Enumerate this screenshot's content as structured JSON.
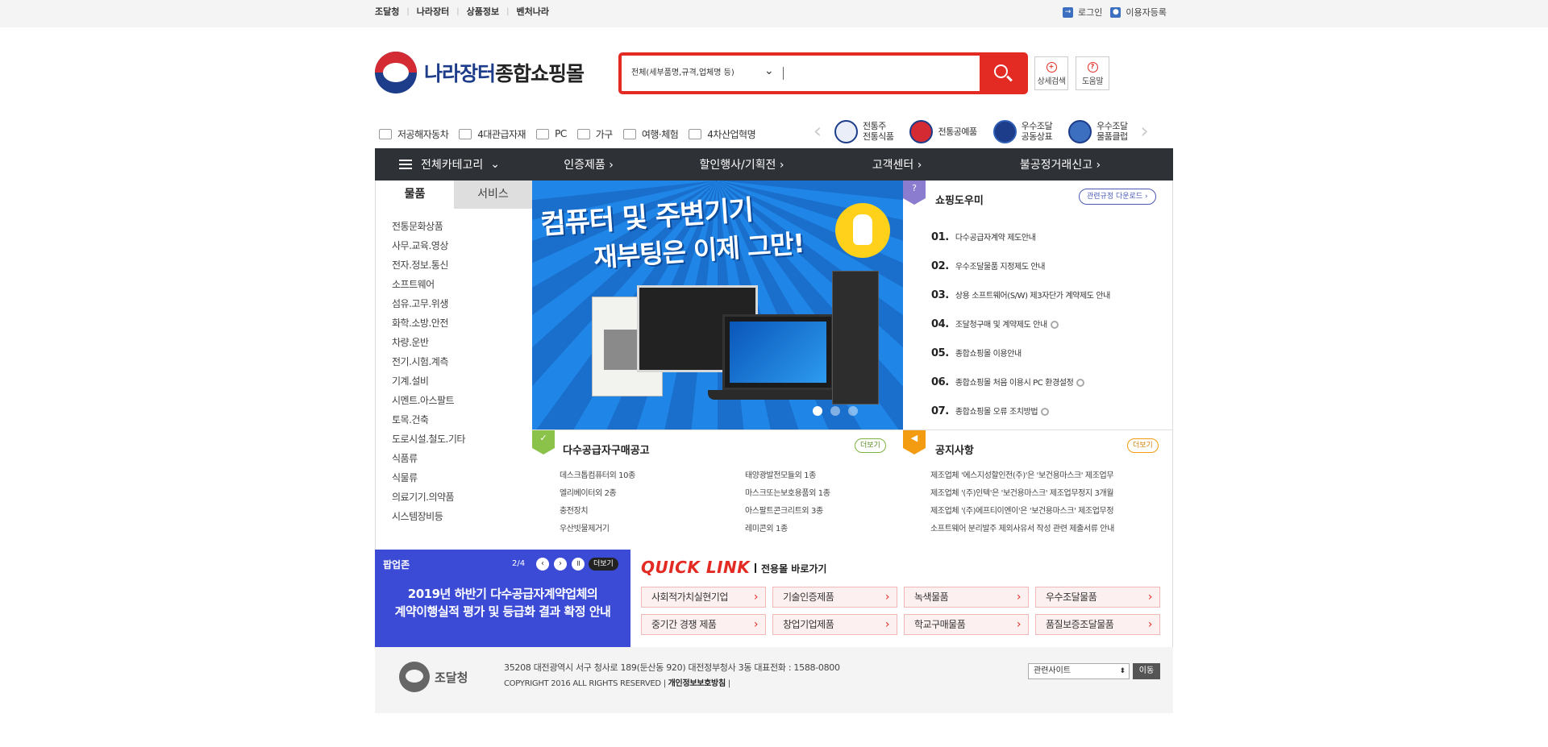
{
  "topbar": {
    "links": [
      "조달청",
      "나라장터",
      "상품정보",
      "벤처나라"
    ],
    "login": "로그인",
    "register": "이용자등록"
  },
  "header": {
    "logo_main": "나라장터",
    "logo_sub": "종합쇼핑몰",
    "search_scope": "전체(세부품명,규격,업체명 등)",
    "search_placeholder": "",
    "detail_search": "상세검색",
    "help": "도움말"
  },
  "quick_categories": [
    {
      "label": "저공해자동차",
      "icon": "car-icon"
    },
    {
      "label": "4대관급자재",
      "icon": "material-icon"
    },
    {
      "label": "PC",
      "icon": "pc-icon"
    },
    {
      "label": "가구",
      "icon": "furniture-icon"
    },
    {
      "label": "여행·체험",
      "icon": "travel-icon"
    },
    {
      "label": "4차산업혁명",
      "icon": "industry-icon"
    }
  ],
  "specials": [
    {
      "line1": "전통주",
      "line2": "전통식품"
    },
    {
      "line1": "전통공예품",
      "line2": ""
    },
    {
      "line1": "우수조달",
      "line2": "공동상표"
    },
    {
      "line1": "우수조달",
      "line2": "물품클럽"
    }
  ],
  "mainnav": {
    "all": "전체카테고리",
    "items": [
      "인증제품",
      "할인행사/기획전",
      "고객센터",
      "불공정거래신고"
    ]
  },
  "category_panel": {
    "tabs": [
      "물품",
      "서비스"
    ],
    "items": [
      "전통문화상품",
      "사무.교육.영상",
      "전자.정보.통신",
      "소프트웨어",
      "섬유.고무.위생",
      "화학.소방.안전",
      "차량.운반",
      "전기.시험.계측",
      "기계.설비",
      "시멘트.아스팔트",
      "토목.건축",
      "도로시설.철도.기타",
      "식품류",
      "식물류",
      "의료기기.의약품",
      "시스템장비등"
    ]
  },
  "banner": {
    "line1": "컴퓨터 및 주변기기",
    "line2": "재부팅은 이제 그만!"
  },
  "help_panel": {
    "title": "쇼핑도우미",
    "download": "관련규정 다운로드",
    "items": [
      {
        "num": "01.",
        "text": "다수공급자계약 제도안내"
      },
      {
        "num": "02.",
        "text": "우수조달물품 지정제도 안내"
      },
      {
        "num": "03.",
        "text": "상용 소프트웨어(S/W) 제3자단가 계약제도 안내"
      },
      {
        "num": "04.",
        "text": "조달청구매 및 계약제도 안내"
      },
      {
        "num": "05.",
        "text": "종합쇼핑몰 이용안내"
      },
      {
        "num": "06.",
        "text": "종합쇼핑몰 처음 이용시 PC 환경설정"
      },
      {
        "num": "07.",
        "text": "종합쇼핑몰 오류 조치방법"
      }
    ]
  },
  "bulk_panel": {
    "title": "다수공급자구매공고",
    "more": "더보기",
    "items": [
      "데스크톱컴퓨터외 10종",
      "태양광발전모듈외 1종",
      "엘리베이터외 2종",
      "마스크또는보호용품외 1종",
      "충전장치",
      "아스팔트콘크리트외 3종",
      "우산빗물제거기",
      "레미콘외 1종"
    ]
  },
  "notice_panel": {
    "title": "공지사항",
    "more": "더보기",
    "items": [
      "제조업체 '에스지성할인전(주)'은 '보건용마스크' 제조업무",
      "제조업체 '(주)인텍'은 '보건용마스크' 제조업무정지 3개월",
      "제조업체 '(주)에프티이엔이'은 '보건용마스크' 제조업무정",
      "소프트웨어 분리발주 제외사유서 작성 관련 제출서류 안내"
    ]
  },
  "popup": {
    "title": "팝업존",
    "page": "2/4",
    "more": "더보기",
    "line1": "2019년 하반기 다수공급자계약업체의",
    "line2": "계약이행실적 평가 및 등급화 결과 확정 안내"
  },
  "quicklink": {
    "title": "QUICK LINK",
    "subtitle": "전용몰 바로가기",
    "buttons": [
      "사회적가치실현기업",
      "기술인증제품",
      "녹색물품",
      "우수조달물품",
      "중기간 경쟁 제품",
      "창업기업제품",
      "학교구매물품",
      "품질보증조달물품"
    ]
  },
  "footer": {
    "logo": "조달청",
    "address": "35208 대전광역시 서구 청사로 189(둔산동 920) 대전정부청사 3동 대표전화 : 1588-0800",
    "copyright": "COPYRIGHT 2016 ALL RIGHTS RESERVED |",
    "privacy": "개인정보보호방침",
    "privacy_suffix": "|",
    "related": "관련사이트",
    "go": "이동"
  },
  "colors": {
    "accent_red": "#e32b24",
    "nav_dark": "#2e3136",
    "brand_blue": "#1d3c8a"
  }
}
